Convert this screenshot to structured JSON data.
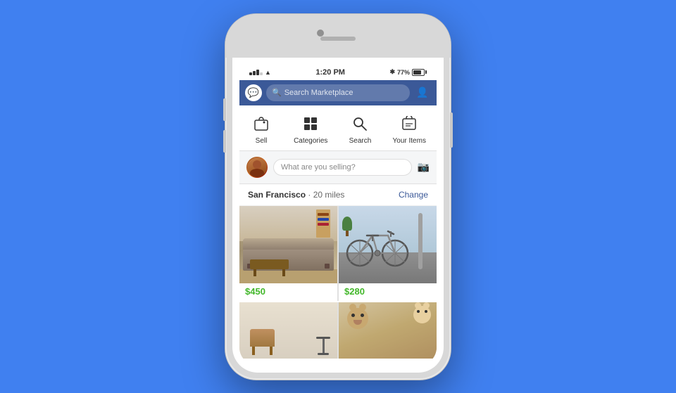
{
  "page": {
    "background_color": "#4080f0"
  },
  "status_bar": {
    "signal": "●●●○○",
    "wifi": "WiFi",
    "time": "1:20 PM",
    "bluetooth": "BT",
    "battery_percent": "77%"
  },
  "nav_bar": {
    "search_placeholder": "Search Marketplace",
    "messenger_label": "Messenger"
  },
  "quick_actions": [
    {
      "id": "sell",
      "label": "Sell",
      "icon": "📷"
    },
    {
      "id": "categories",
      "label": "Categories",
      "icon": "🏷"
    },
    {
      "id": "search",
      "label": "Search",
      "icon": "🔍"
    },
    {
      "id": "your-items",
      "label": "Your Items",
      "icon": "🛒"
    }
  ],
  "sell_input": {
    "placeholder": "What are you selling?"
  },
  "location": {
    "city": "San Francisco",
    "distance": "20 miles",
    "change_label": "Change"
  },
  "listings": [
    {
      "id": "sofa",
      "type": "sofa",
      "price": "$450",
      "price_color": "#42b72a"
    },
    {
      "id": "bike",
      "type": "bike",
      "price": "$280",
      "price_color": "#42b72a"
    }
  ],
  "listings_row2": [
    {
      "id": "lamp",
      "type": "lamp"
    },
    {
      "id": "bear",
      "type": "bear"
    }
  ]
}
